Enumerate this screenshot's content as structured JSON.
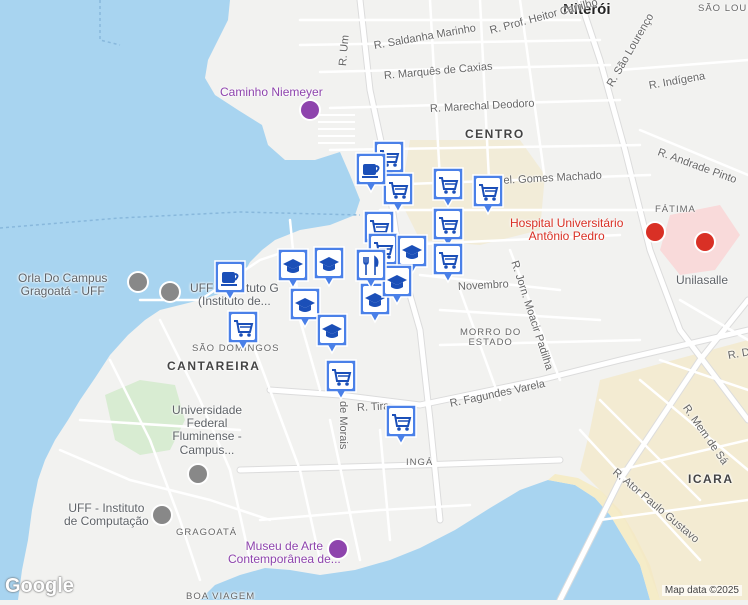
{
  "map": {
    "city_label": "Niterói",
    "districts": [
      {
        "id": "centro",
        "text": "CENTRO"
      },
      {
        "id": "fatima",
        "text": "FÁTIMA"
      },
      {
        "id": "sao-domingos",
        "text": "SÃO DOMINGOS"
      },
      {
        "id": "cantareira",
        "text": "CANTAREIRA"
      },
      {
        "id": "morro-do-estado",
        "text": "MORRO DO\nESTADO"
      },
      {
        "id": "inga",
        "text": "INGÁ"
      },
      {
        "id": "gragoata",
        "text": "GRAGOATÁ"
      },
      {
        "id": "boa-viagem",
        "text": "BOA VIAGEM"
      },
      {
        "id": "icarai",
        "text": "ICARA"
      },
      {
        "id": "sao-lourenco",
        "text": "SÃO LOUR"
      }
    ],
    "streets": [
      {
        "id": "saldanha-marinho",
        "text": "R. Saldanha Marinho"
      },
      {
        "id": "heitor-carrilho",
        "text": "R. Prof. Heitor Carrilho"
      },
      {
        "id": "marques-caxias",
        "text": "R. Marquês de Caxias"
      },
      {
        "id": "marechal-deodoro",
        "text": "R. Marechal Deodoro"
      },
      {
        "id": "sao-lourenco",
        "text": "R. São Lourenço"
      },
      {
        "id": "indigena",
        "text": "R. Indígena"
      },
      {
        "id": "andrade-pinto",
        "text": "R. Andrade Pinto"
      },
      {
        "id": "gomes-machado",
        "text": "cel. Gomes Machado"
      },
      {
        "id": "um",
        "text": "R. Um"
      },
      {
        "id": "novembro",
        "text": "Novembro"
      },
      {
        "id": "moacir-padilha",
        "text": "R. Jorn. Moacir Padilha"
      },
      {
        "id": "fagundes-varela",
        "text": "R. Fagundes Varela"
      },
      {
        "id": "tiradentes",
        "text": "R. Tira"
      },
      {
        "id": "de-morais",
        "text": "de Morais"
      },
      {
        "id": "mem-de-sa",
        "text": "R. Mem de Sá"
      },
      {
        "id": "ator-paulo-gustavo",
        "text": "R. Ator Paulo Gustavo"
      },
      {
        "id": "r-d",
        "text": "R. D"
      }
    ],
    "pois": [
      {
        "id": "caminho-niemeyer",
        "text": "Caminho Niemeyer",
        "icon": "museum-icon"
      },
      {
        "id": "hospital",
        "text": "Hospital Universitário\nAntônio Pedro",
        "icon": "hospital-icon"
      },
      {
        "id": "orla",
        "text": "Orla Do Campus\nGragoatá - UFF",
        "icon": "school-icon"
      },
      {
        "id": "uff-instituto",
        "text": "UFF - Instituto G\n(Instituto de...",
        "icon": "school-icon"
      },
      {
        "id": "uff-federal",
        "text": "Universidade\nFederal\nFluminense -\nCampus...",
        "icon": "school-icon"
      },
      {
        "id": "uff-computacao",
        "text": "UFF - Instituto\nde Computação",
        "icon": "school-icon"
      },
      {
        "id": "mac",
        "text": "Museu de Arte\nContemporânea de...",
        "icon": "museum-icon"
      },
      {
        "id": "unilasalle",
        "text": "Unilasalle",
        "icon": ""
      }
    ],
    "markers": [
      {
        "type": "shopping-cart",
        "label": "shopping-cart-marker"
      },
      {
        "type": "shopping-cart",
        "label": "shopping-cart-marker"
      },
      {
        "type": "shopping-cart",
        "label": "shopping-cart-marker"
      },
      {
        "type": "shopping-cart",
        "label": "shopping-cart-marker"
      },
      {
        "type": "shopping-cart",
        "label": "shopping-cart-marker"
      },
      {
        "type": "shopping-cart",
        "label": "shopping-cart-marker"
      },
      {
        "type": "shopping-cart",
        "label": "shopping-cart-marker"
      },
      {
        "type": "shopping-cart",
        "label": "shopping-cart-marker"
      },
      {
        "type": "shopping-cart",
        "label": "shopping-cart-marker"
      },
      {
        "type": "shopping-cart",
        "label": "shopping-cart-marker"
      },
      {
        "type": "shopping-cart",
        "label": "shopping-cart-marker"
      },
      {
        "type": "coffee-cup",
        "label": "cafe-marker"
      },
      {
        "type": "coffee-cup",
        "label": "cafe-marker"
      },
      {
        "type": "graduation-cap",
        "label": "school-marker"
      },
      {
        "type": "graduation-cap",
        "label": "school-marker"
      },
      {
        "type": "graduation-cap",
        "label": "school-marker"
      },
      {
        "type": "graduation-cap",
        "label": "school-marker"
      },
      {
        "type": "graduation-cap",
        "label": "school-marker"
      },
      {
        "type": "graduation-cap",
        "label": "school-marker"
      },
      {
        "type": "graduation-cap",
        "label": "school-marker"
      },
      {
        "type": "fork-knife",
        "label": "restaurant-marker"
      }
    ],
    "colors": {
      "water": "#a8d4f0",
      "land": "#f2f2f0",
      "road": "#ffffff",
      "road_outline": "#dcdcdc",
      "marker_fill": "#4a80e8",
      "marker_inner": "#ffffff",
      "marker_icon": "#1b4fb8",
      "poi_purple": "#8e44ad",
      "poi_red": "#d93025",
      "beach": "#f5ecc8"
    },
    "logo": "Google",
    "attribution": "Map data ©2025"
  }
}
